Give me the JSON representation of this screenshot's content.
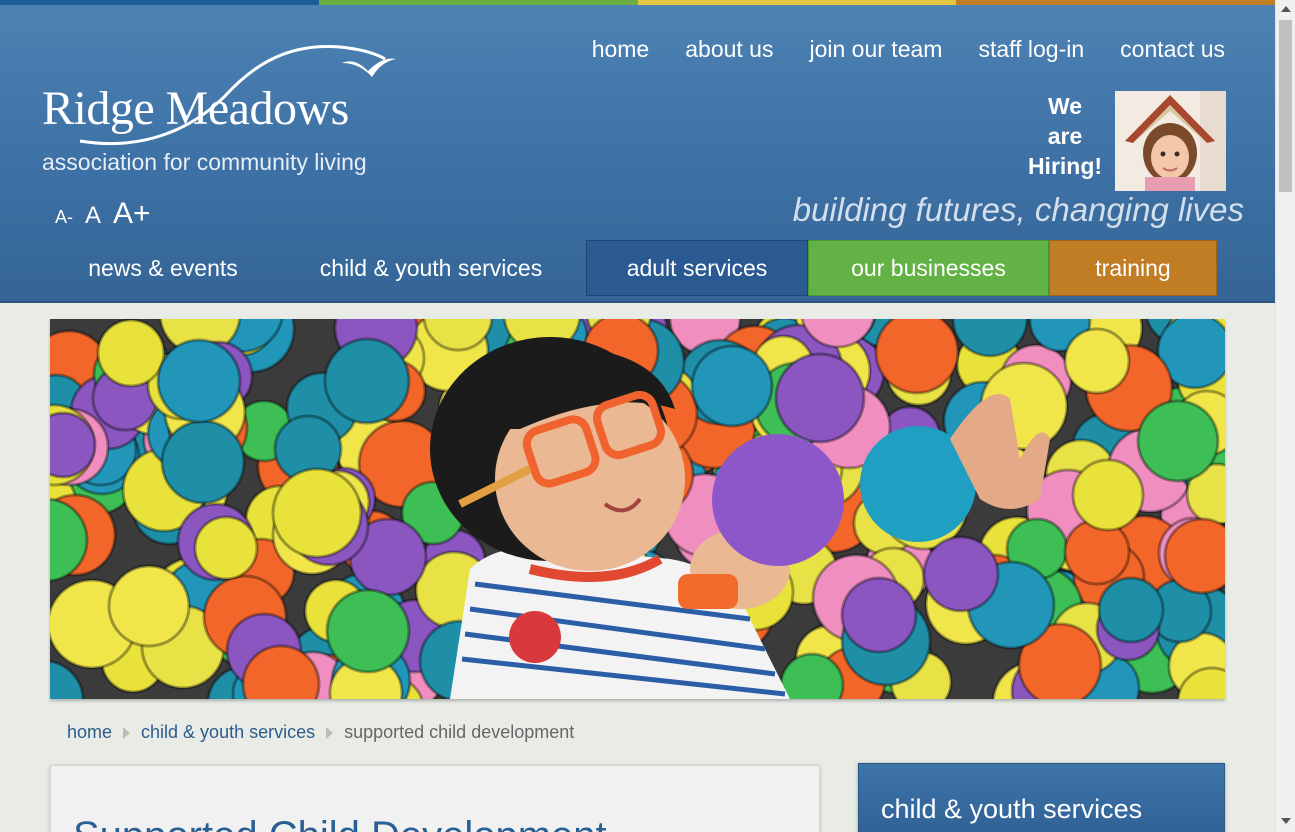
{
  "colors": {
    "stripe_blue": "#1f5d99",
    "stripe_green": "#6aae44",
    "stripe_yellow": "#e2c744",
    "stripe_orange": "#c07d24",
    "header": "#3f74a8",
    "link": "#2b5c8c"
  },
  "logo": {
    "name": "Ridge Meadows",
    "subtitle": "association for community living",
    "icon": "bird-swoosh-icon"
  },
  "topnav": [
    "home",
    "about us",
    "join our team",
    "staff log-in",
    "contact us"
  ],
  "hiring": {
    "line1": "We",
    "line2": "are",
    "line3": "Hiring!",
    "photo": "girl-under-book-photo"
  },
  "fontsize": {
    "small": "A-",
    "normal": "A",
    "large": "A+"
  },
  "tagline": "building futures, changing lives",
  "mainnav": [
    "news & events",
    "child & youth services",
    "adult services",
    "our businesses",
    "training"
  ],
  "hero": {
    "image": "child-in-ball-pit-photo"
  },
  "breadcrumb": {
    "home": "home",
    "parent": "child & youth services",
    "current": "supported child development"
  },
  "content": {
    "title": "Supported Child Development"
  },
  "sidebar": {
    "title": "child & youth services"
  }
}
